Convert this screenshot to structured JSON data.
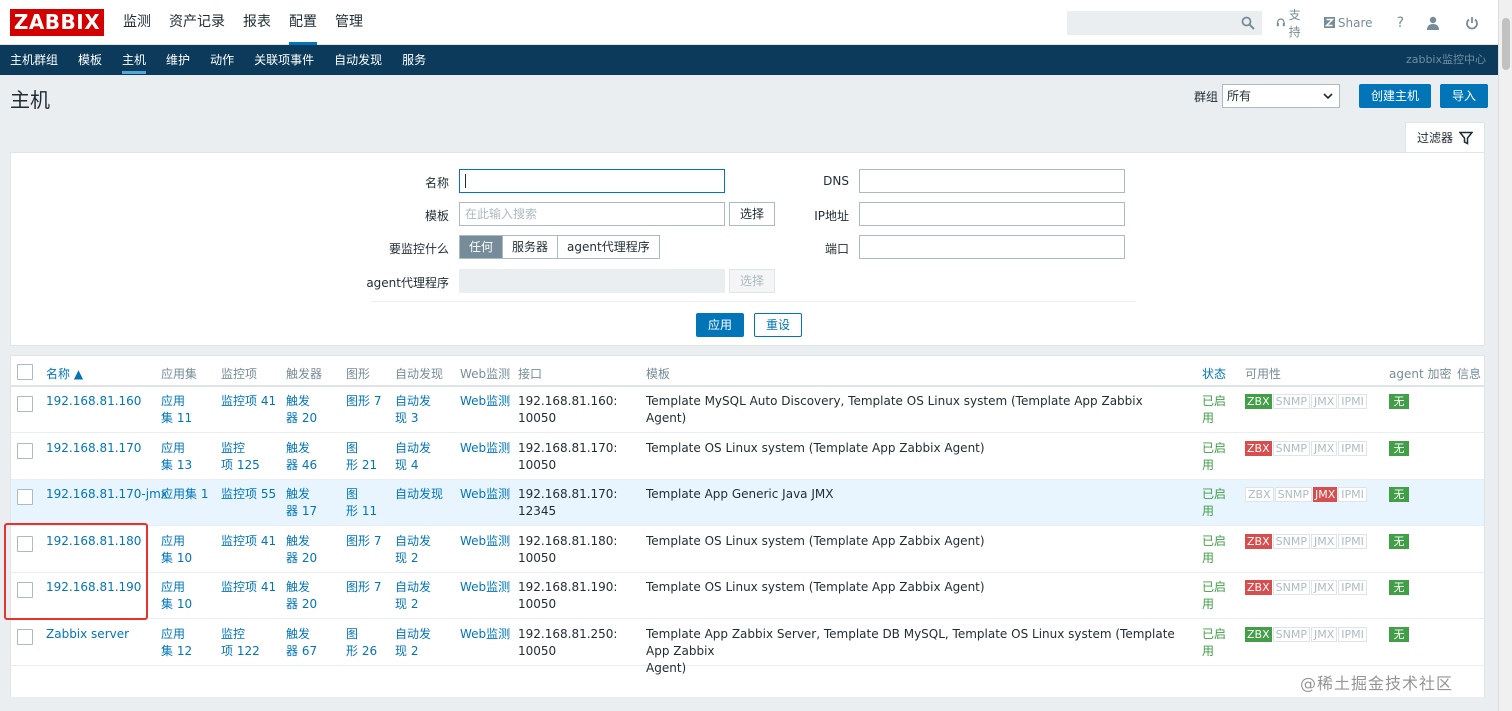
{
  "logo": "ZABBIX",
  "topnav": [
    "监测",
    "资产记录",
    "报表",
    "配置",
    "管理"
  ],
  "topnav_active": 3,
  "top_right": {
    "support": "支持",
    "share": "Share",
    "help": "?"
  },
  "subnav": [
    "主机群组",
    "模板",
    "主机",
    "维护",
    "动作",
    "关联项事件",
    "自动发现",
    "服务"
  ],
  "subnav_active": 2,
  "server_name": "zabbix监控中心",
  "page_title": "主机",
  "group_label": "群组",
  "group_value": "所有",
  "create_host": "创建主机",
  "import": "导入",
  "filter_tab": "过滤器",
  "filter": {
    "name_label": "名称",
    "name_value": "",
    "template_label": "模板",
    "template_placeholder": "在此输入搜索",
    "select": "选择",
    "monitor_label": "要监控什么",
    "monitor_options": [
      "任何",
      "服务器",
      "agent代理程序"
    ],
    "proxy_label": "agent代理程序",
    "dns_label": "DNS",
    "ip_label": "IP地址",
    "port_label": "端口",
    "apply": "应用",
    "reset": "重设"
  },
  "columns": {
    "name": "名称 ▲",
    "apps": "应用集",
    "items": "监控项",
    "triggers": "触发器",
    "graphs": "图形",
    "discovery": "自动发现",
    "web": "Web监测",
    "interface": "接口",
    "templates": "模板",
    "status": "状态",
    "availability": "可用性",
    "encryption": "agent 加密",
    "info": "信息"
  },
  "rows": [
    {
      "name": "192.168.81.160",
      "apps_l1": "应用",
      "apps_l2": "集 11",
      "items_l1": "监控项 41",
      "items_l2": "",
      "trig_l1": "触发",
      "trig_l2": "器 20",
      "graph_l1": "图形 7",
      "graph_l2": "",
      "disc_l1": "自动发",
      "disc_l2": "现 3",
      "web": "Web监测",
      "if_l1": "192.168.81.160:",
      "if_l2": "10050",
      "tpl_l1": "Template MySQL Auto Discovery, Template OS Linux system (Template App Zabbix Agent)",
      "tpl_l2": "",
      "status_l1": "已启",
      "status_l2": "用",
      "zbx": "ok",
      "snmp": "grey",
      "jmx": "grey",
      "ipmi": "grey",
      "enc": "无"
    },
    {
      "name": "192.168.81.170",
      "apps_l1": "应用",
      "apps_l2": "集 13",
      "items_l1": "监控",
      "items_l2": "项 125",
      "trig_l1": "触发",
      "trig_l2": "器 46",
      "graph_l1": "图",
      "graph_l2": "形 21",
      "disc_l1": "自动发",
      "disc_l2": "现 4",
      "web": "Web监测",
      "if_l1": "192.168.81.170:",
      "if_l2": "10050",
      "tpl_l1": "Template OS Linux system (Template App Zabbix Agent)",
      "tpl_l2": "",
      "status_l1": "已启",
      "status_l2": "用",
      "zbx": "bad",
      "snmp": "grey",
      "jmx": "grey",
      "ipmi": "grey",
      "enc": "无"
    },
    {
      "name": "192.168.81.170-jmx",
      "apps_l1": "应用集 1",
      "apps_l2": "",
      "items_l1": "监控项 55",
      "items_l2": "",
      "trig_l1": "触发",
      "trig_l2": "器 17",
      "graph_l1": "图",
      "graph_l2": "形 11",
      "disc_l1": "自动发现",
      "disc_l2": "",
      "web": "Web监测",
      "if_l1": "192.168.81.170:",
      "if_l2": "12345",
      "tpl_l1": "Template App Generic Java JMX",
      "tpl_l2": "",
      "status_l1": "已启",
      "status_l2": "用",
      "zbx": "grey",
      "snmp": "grey",
      "jmx": "bad",
      "ipmi": "grey",
      "enc": "无"
    },
    {
      "name": "192.168.81.180",
      "apps_l1": "应用",
      "apps_l2": "集 10",
      "items_l1": "监控项 41",
      "items_l2": "",
      "trig_l1": "触发",
      "trig_l2": "器 20",
      "graph_l1": "图形 7",
      "graph_l2": "",
      "disc_l1": "自动发",
      "disc_l2": "现 2",
      "web": "Web监测",
      "if_l1": "192.168.81.180:",
      "if_l2": "10050",
      "tpl_l1": "Template OS Linux system (Template App Zabbix Agent)",
      "tpl_l2": "",
      "status_l1": "已启",
      "status_l2": "用",
      "zbx": "bad",
      "snmp": "grey",
      "jmx": "grey",
      "ipmi": "grey",
      "enc": "无"
    },
    {
      "name": "192.168.81.190",
      "apps_l1": "应用",
      "apps_l2": "集 10",
      "items_l1": "监控项 41",
      "items_l2": "",
      "trig_l1": "触发",
      "trig_l2": "器 20",
      "graph_l1": "图形 7",
      "graph_l2": "",
      "disc_l1": "自动发",
      "disc_l2": "现 2",
      "web": "Web监测",
      "if_l1": "192.168.81.190:",
      "if_l2": "10050",
      "tpl_l1": "Template OS Linux system (Template App Zabbix Agent)",
      "tpl_l2": "",
      "status_l1": "已启",
      "status_l2": "用",
      "zbx": "bad",
      "snmp": "grey",
      "jmx": "grey",
      "ipmi": "grey",
      "enc": "无"
    },
    {
      "name": "Zabbix server",
      "apps_l1": "应用",
      "apps_l2": "集 12",
      "items_l1": "监控",
      "items_l2": "项 122",
      "trig_l1": "触发",
      "trig_l2": "器 67",
      "graph_l1": "图",
      "graph_l2": "形 26",
      "disc_l1": "自动发",
      "disc_l2": "现 2",
      "web": "Web监测",
      "if_l1": "192.168.81.250:",
      "if_l2": "10050",
      "tpl_l1": "Template App Zabbix Server, Template DB MySQL, Template OS Linux system (Template App Zabbix",
      "tpl_l2": "Agent)",
      "status_l1": "已启",
      "status_l2": "用",
      "zbx": "ok",
      "snmp": "grey",
      "jmx": "grey",
      "ipmi": "grey",
      "enc": "无"
    }
  ],
  "badge_labels": {
    "zbx": "ZBX",
    "snmp": "SNMP",
    "jmx": "JMX",
    "ipmi": "IPMI"
  },
  "watermark": "@稀土掘金技术社区",
  "colors": {
    "brand": "#d40000",
    "accent": "#0275b8",
    "subnav": "#0b3a5a",
    "ok": "#429e47",
    "bad": "#d64e4e",
    "highlight_box": "#e8332d"
  }
}
